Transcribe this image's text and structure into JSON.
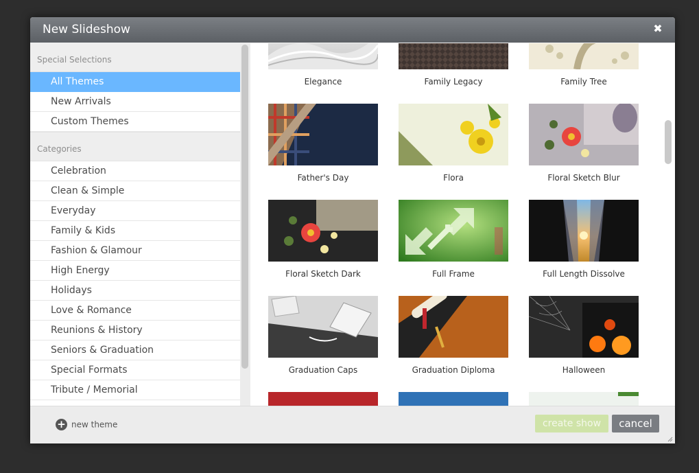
{
  "dialog": {
    "title": "New Slideshow",
    "close_glyph": "✖"
  },
  "sidebar": {
    "special_header": "Special Selections",
    "special_items": [
      "All Themes",
      "New Arrivals",
      "Custom Themes"
    ],
    "active_item": "All Themes",
    "categories_header": "Categories",
    "category_items": [
      "Celebration",
      "Clean & Simple",
      "Everyday",
      "Family & Kids",
      "Fashion & Glamour",
      "High Energy",
      "Holidays",
      "Love & Romance",
      "Reunions & History",
      "Seniors & Graduation",
      "Special Formats",
      "Tribute / Memorial"
    ]
  },
  "themes": [
    {
      "name": "Elegance",
      "thumbnail": "silver-waves"
    },
    {
      "name": "Family Legacy",
      "thumbnail": "brown-diamond-pattern"
    },
    {
      "name": "Family Tree",
      "thumbnail": "beige-tree"
    },
    {
      "name": "Father's Day",
      "thumbnail": "plaid-and-denim"
    },
    {
      "name": "Flora",
      "thumbnail": "yellow-flowers"
    },
    {
      "name": "Floral Sketch Blur",
      "thumbnail": "red-flower-window"
    },
    {
      "name": "Floral Sketch Dark",
      "thumbnail": "red-flower-dark"
    },
    {
      "name": "Full Frame",
      "thumbnail": "green-expand-arrows"
    },
    {
      "name": "Full Length Dissolve",
      "thumbnail": "train-corridor-sunset"
    },
    {
      "name": "Graduation Caps",
      "thumbnail": "grad-caps-gray"
    },
    {
      "name": "Graduation Diploma",
      "thumbnail": "diploma-on-wood"
    },
    {
      "name": "Halloween",
      "thumbnail": "cobweb-jack-o-lanterns"
    },
    {
      "name": "",
      "thumbnail": "red-partial"
    },
    {
      "name": "",
      "thumbnail": "blue-partial"
    },
    {
      "name": "",
      "thumbnail": "white-green-partial"
    }
  ],
  "footer": {
    "new_theme_label": "new theme",
    "create_show_label": "create show",
    "cancel_label": "cancel"
  },
  "colors": {
    "accent_selected": "#6ab7ff",
    "create_button_disabled": "#cfe3a8",
    "cancel_button": "#7a7d82",
    "titlebar": "#6b6f74"
  }
}
